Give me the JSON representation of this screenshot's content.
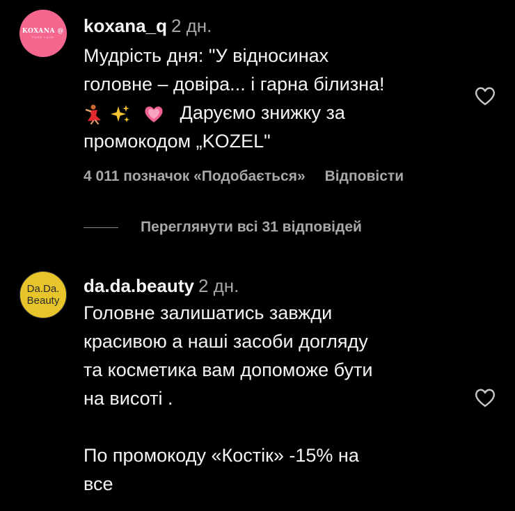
{
  "comments": [
    {
      "avatar_brand": "KOXANA @",
      "avatar_sub": "PURE LACE",
      "username": "koxana_q",
      "time": "2 дн.",
      "line1": "Мудрість дня: \"У відносинах",
      "line2": "головне – довіра... і гарна білизна!",
      "line3": "Даруємо знижку за",
      "line4": "промокодом „KOZEL\"",
      "likes": "4 011 позначок «Подобається»",
      "reply": "Відповісти",
      "view_replies": "Переглянути всі 31 відповідей"
    },
    {
      "avatar_line1": "Da.Da.",
      "avatar_line2": "Beauty",
      "username": "da.da.beauty",
      "time": "2 дн.",
      "line1": "Головне залишатись завжди",
      "line2": "красивою а наші засоби догляду",
      "line3": "та косметика вам допоможе бути",
      "line4": "на висоті .",
      "line5": "По промокоду «Костік» -15% на",
      "line6": "все"
    }
  ],
  "icons": {
    "dancer": "dancer-emoji",
    "sparkles": "sparkles-emoji",
    "heart_emoji": "growing-heart-emoji",
    "like": "heart-outline-icon"
  },
  "colors": {
    "background": "#000000",
    "text": "#f5f5f5",
    "muted": "#a8a8a8",
    "avatar_pink": "#f5668f",
    "avatar_yellow": "#e7c52a"
  }
}
